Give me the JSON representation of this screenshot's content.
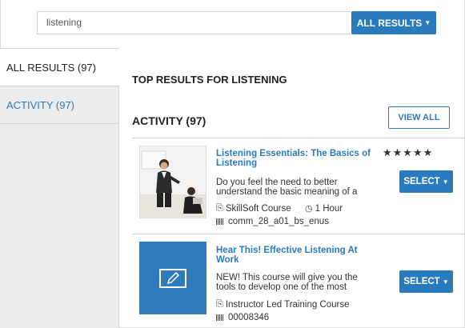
{
  "search": {
    "value": "listening",
    "scope_button": "ALL RESULTS"
  },
  "sidebar": {
    "items": [
      {
        "label": "ALL RESULTS (97)"
      },
      {
        "label": "ACTIVITY (97)"
      }
    ]
  },
  "main": {
    "heading": "TOP RESULTS FOR LISTENING",
    "section_title": "ACTIVITY (97)",
    "view_all_label": "VIEW ALL",
    "items": [
      {
        "title_line1": "Listening Essentials: The Basics of",
        "title_line2": "Listening",
        "desc_line1": "Do you feel the need to better",
        "desc_line2": "understand the basic meaning of a",
        "type": "SkillSoft Course",
        "duration": "1 Hour",
        "code": "comm_28_a01_bs_enus",
        "rating": "★★★★★",
        "rating_value": 5,
        "select_label": "SELECT"
      },
      {
        "title_line1": "Hear This! Effective Listening At",
        "title_line2": "Work",
        "desc_line1": "NEW! This course will give you the",
        "desc_line2": "tools to develop one of the most",
        "type": "Instructor Led Training Course",
        "code": "00008346",
        "select_label": "SELECT"
      }
    ]
  },
  "colors": {
    "accent": "#2a7bbd",
    "sidebar_bg": "#ececec"
  }
}
